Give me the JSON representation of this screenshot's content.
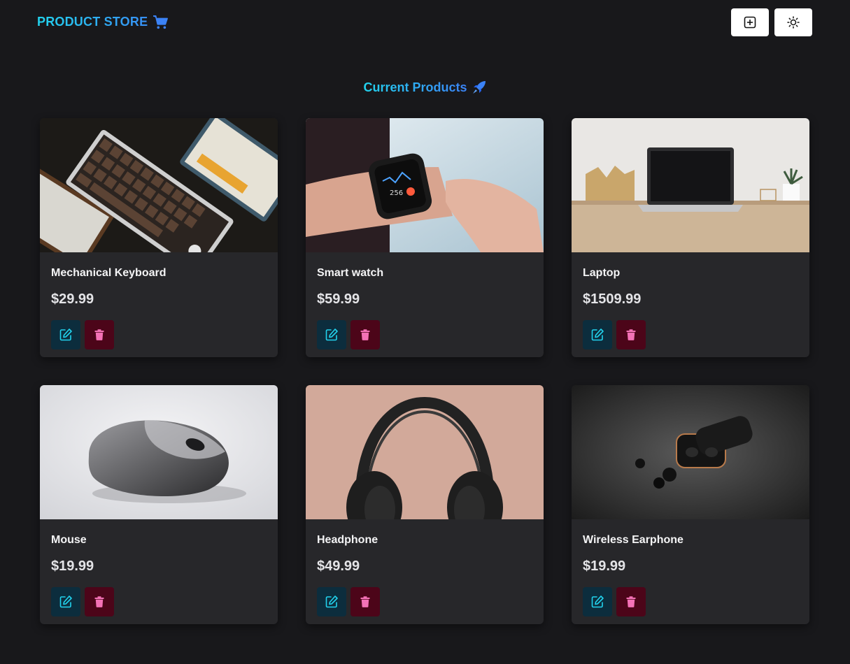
{
  "navbar": {
    "brand": "PRODUCT STORE",
    "brand_icon": "shopping-cart-icon",
    "create_button_icon": "plus-square-icon",
    "theme_button_icon": "sun-icon"
  },
  "main": {
    "heading": "Current Products",
    "heading_icon": "rocket-icon"
  },
  "products": [
    {
      "name": "Mechanical Keyboard",
      "price": "$29.99",
      "image": "keyboard-photo"
    },
    {
      "name": "Smart watch",
      "price": "$59.99",
      "image": "smartwatch-photo"
    },
    {
      "name": "Laptop",
      "price": "$1509.99",
      "image": "laptop-photo"
    },
    {
      "name": "Mouse",
      "price": "$19.99",
      "image": "mouse-photo"
    },
    {
      "name": "Headphone",
      "price": "$49.99",
      "image": "headphone-photo"
    },
    {
      "name": "Wireless Earphone",
      "price": "$19.99",
      "image": "earphone-photo"
    }
  ],
  "colors": {
    "background": "#18181b",
    "card": "#27272a",
    "accent_gradient": [
      "#22d3ee",
      "#3b82f6"
    ],
    "edit_icon": "#22d3ee",
    "delete_icon": "#f472b6"
  }
}
